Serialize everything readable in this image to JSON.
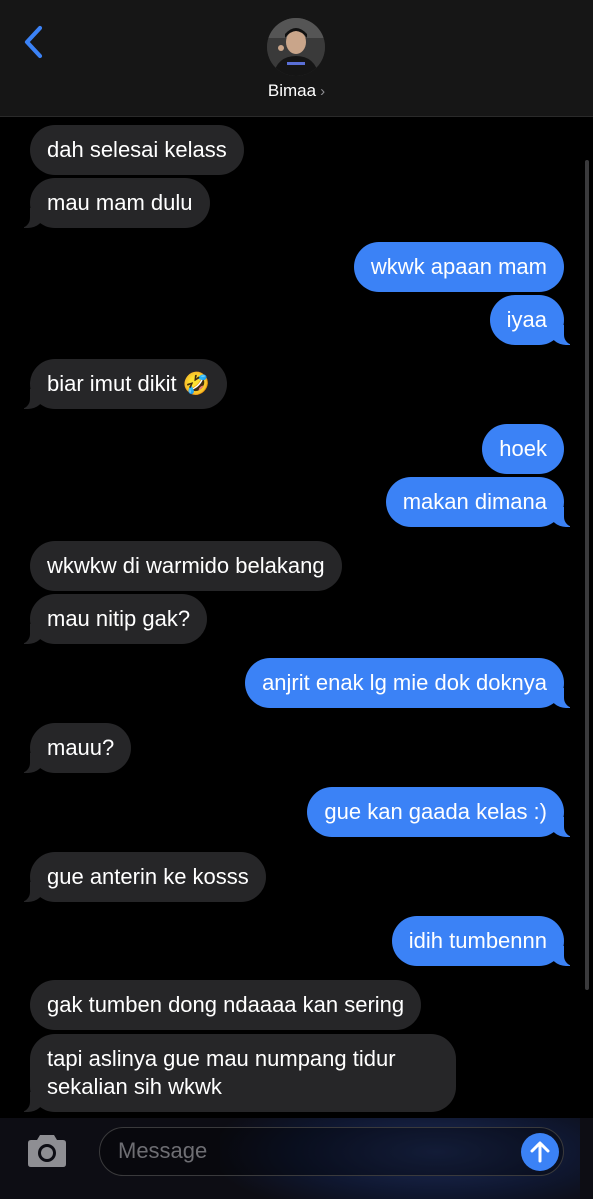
{
  "header": {
    "contact_name": "Bimaa",
    "chevron": "›",
    "back_icon": "chevron-left-icon",
    "accent": "#3b82f6"
  },
  "messages": [
    {
      "side": "in",
      "text": "dah selesai kelass"
    },
    {
      "side": "in",
      "text": "mau mam dulu"
    },
    {
      "side": "out",
      "text": "wkwk apaan mam"
    },
    {
      "side": "out",
      "text": "iyaa"
    },
    {
      "side": "in",
      "text": "biar imut dikit 🤣"
    },
    {
      "side": "out",
      "text": "hoek"
    },
    {
      "side": "out",
      "text": "makan dimana"
    },
    {
      "side": "in",
      "text": "wkwkw di warmido belakang"
    },
    {
      "side": "in",
      "text": "mau nitip gak?"
    },
    {
      "side": "out",
      "text": "anjrit enak lg mie dok doknya"
    },
    {
      "side": "in",
      "text": "mauu?"
    },
    {
      "side": "out",
      "text": "gue kan gaada kelas :)"
    },
    {
      "side": "in",
      "text": "gue anterin ke kosss"
    },
    {
      "side": "out",
      "text": "idih tumbennn"
    },
    {
      "side": "in",
      "text": "gak tumben dong ndaaaa kan sering"
    },
    {
      "side": "in",
      "text": "tapi aslinya gue mau numpang tidur\nsekalian sih wkwk"
    }
  ],
  "composer": {
    "placeholder": "Message",
    "camera_icon": "camera-icon",
    "send_icon": "arrow-up-icon"
  },
  "colors": {
    "incoming_bubble": "#262628",
    "outgoing_bubble": "#3b82f6",
    "background": "#000000"
  }
}
